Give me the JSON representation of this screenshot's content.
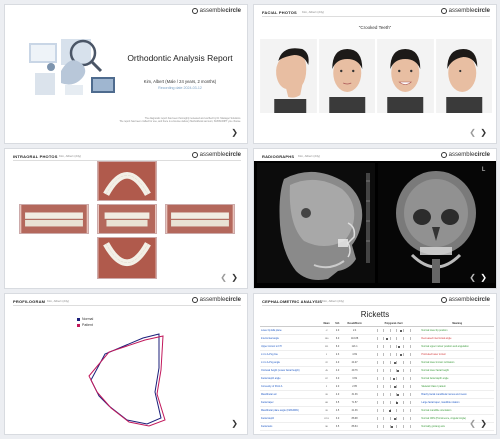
{
  "cover": {
    "title": "Orthodontic Analysis Report",
    "patient": "Kim, Albert (Male / 24 years, 2 months)",
    "date": "Recording date 2024-03-12",
    "note_line1": "The diagnostic report has been thoroughly reviewed and verified by Dr. Manager Solutions.",
    "note_line2": "The report has been crafted for use, and there is a license delivery Methodbook account, SUBSCRIPT you choose."
  },
  "logo": {
    "part1": "assemble",
    "part2": "circle"
  },
  "facial": {
    "title": "FACIAL PHOTOS",
    "sub": "Kim, Albert (24y)",
    "caption": "\"Crooked Teeth\""
  },
  "intraoral": {
    "title": "INTRAORAL PHOTOS",
    "sub": "Kim, Albert (24y)"
  },
  "radiographs": {
    "title": "RADIOGRAPHS",
    "sub": "Kim, Albert (24y)"
  },
  "profilogram": {
    "title": "PROFILOGRAM",
    "sub": "Kim, Albert (24y)",
    "legend": [
      {
        "label": "Normal",
        "color": "#1b1f7a"
      },
      {
        "label": "Patient",
        "color": "#c2185b"
      }
    ]
  },
  "ceph": {
    "title": "CEPHALOMETRIC ANALYSIS",
    "sub": "Kim, Albert (24y)",
    "heading": "Ricketts",
    "columns": [
      "",
      "Mean",
      "S.D.",
      "Result/Norm",
      "Polygonal chart",
      "Meaning"
    ],
    "rows": [
      {
        "name": "Lower lip E/E plane",
        "mean": "-2",
        "sd": "2.0",
        "res": "2.4",
        "dot": 0.72,
        "meaning": "Normal lower lip position",
        "mc": "m-green"
      },
      {
        "name": "Interincisal angle",
        "mean": "130",
        "sd": "6.0",
        "res": "116.88",
        "dot": 0.28,
        "meaning": "Decreased interincisal angle",
        "mc": "m-red"
      },
      {
        "name": "Upper incisor to FH",
        "mean": "111",
        "sd": "6.0",
        "res": "121.1",
        "dot": 0.68,
        "meaning": "Normal upper incisor position and angulation",
        "mc": "m-green"
      },
      {
        "name": "L1 to A-Pog line",
        "mean": "1",
        "sd": "2.3",
        "res": "4.69",
        "dot": 0.74,
        "meaning": "Protruded lower incisor",
        "mc": "m-red"
      },
      {
        "name": "L1 to A-Pog angle",
        "mean": "22",
        "sd": "4.0",
        "res": "24.07",
        "dot": 0.56,
        "meaning": "Normal lower incisor inclination",
        "mc": "m-green"
      },
      {
        "name": "Occlusal height (Lower facial height)",
        "mean": "45",
        "sd": "4.0",
        "res": "49.76",
        "dot": 0.63,
        "meaning": "Normal lower facial height",
        "mc": "m-green"
      },
      {
        "name": "Facial depth angle",
        "mean": "87",
        "sd": "3.0",
        "res": "3.69",
        "dot": 0.5,
        "meaning": "Normal facial depth angle",
        "mc": "m-green"
      },
      {
        "name": "Convexity of Point A",
        "mean": "2",
        "sd": "2.0",
        "res": "2.85",
        "dot": 0.55,
        "meaning": "Skeletal Class I pattern",
        "mc": "m-green"
      },
      {
        "name": "Mandibular arc",
        "mean": "26",
        "sd": "4.0",
        "res": "31.36",
        "dot": 0.64,
        "meaning": "Brachy facial mandibular ramus and mesio",
        "mc": "m-blue"
      },
      {
        "name": "Facial taper",
        "mean": "68",
        "sd": "3.5",
        "res": "71.57",
        "dot": 0.6,
        "meaning": "Large facial taper, mandible rotation",
        "mc": "m-blue"
      },
      {
        "name": "Mandibular plane angle (FMA/MPA)",
        "mean": "26",
        "sd": "4.5",
        "res": "21.36",
        "dot": 0.38,
        "meaning": "Normal mandible orientation",
        "mc": "m-green"
      },
      {
        "name": "Facial depth",
        "mean": "87.9",
        "sd": "3.0",
        "res": "88.98",
        "dot": 0.53,
        "meaning": "Normal CRN (Prominence, Angular Angle)",
        "mc": "m-green"
      },
      {
        "name": "Facial axis",
        "mean": "90",
        "sd": "3.5",
        "res": "88.64",
        "dot": 0.46,
        "meaning": "Normally growing axis",
        "mc": "m-green"
      }
    ]
  }
}
